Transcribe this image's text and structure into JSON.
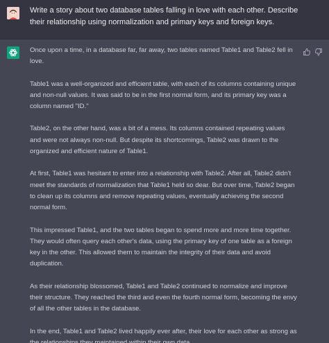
{
  "user_message": {
    "text": "Write a story about two database tables falling in love with each other. Describe their relationship using normalization and primary keys and foreign keys."
  },
  "assistant_message": {
    "paragraphs": [
      "Once upon a time, in a database far, far away, two tables named Table1 and Table2 fell in love.",
      "Table1 was a well-organized and efficient table, with each of its columns containing unique and non-null values. It was said to be in the first normal form, and its primary key was a column named \"ID.\"",
      "Table2, on the other hand, was a bit of a mess. Its columns contained repeating values and were not always non-null. But despite its shortcomings, Table2 was drawn to the organized and efficient nature of Table1.",
      "At first, Table1 was hesitant to enter into a relationship with Table2. After all, Table2 didn't meet the standards of normalization that Table1 held so dear. But over time, Table2 began to clean up its columns and remove repeating values, eventually achieving the second normal form.",
      "This impressed Table1, and the two tables began to spend more and more time together. They would often query each other's data, using the primary key of one table as a foreign key in the other. This allowed them to maintain the integrity of their data and avoid duplication.",
      "As their relationship blossomed, Table1 and Table2 continued to normalize and improve their structure. They reached the third and even the fourth normal form, becoming the envy of all the other tables in the database.",
      "In the end, Table1 and Table2 lived happily ever after, their love for each other as strong as the relationships they maintained within their own data."
    ]
  },
  "icons": {
    "user_avatar": "user-avatar-icon",
    "assistant_avatar": "openai-logo-icon",
    "feedback_up": "thumbs-up-icon",
    "feedback_down": "thumbs-down-icon"
  },
  "colors": {
    "user_row_bg": "#343541",
    "assistant_row_bg": "#444654",
    "assistant_avatar_bg": "#10a37f",
    "text": "#d1d5db"
  }
}
